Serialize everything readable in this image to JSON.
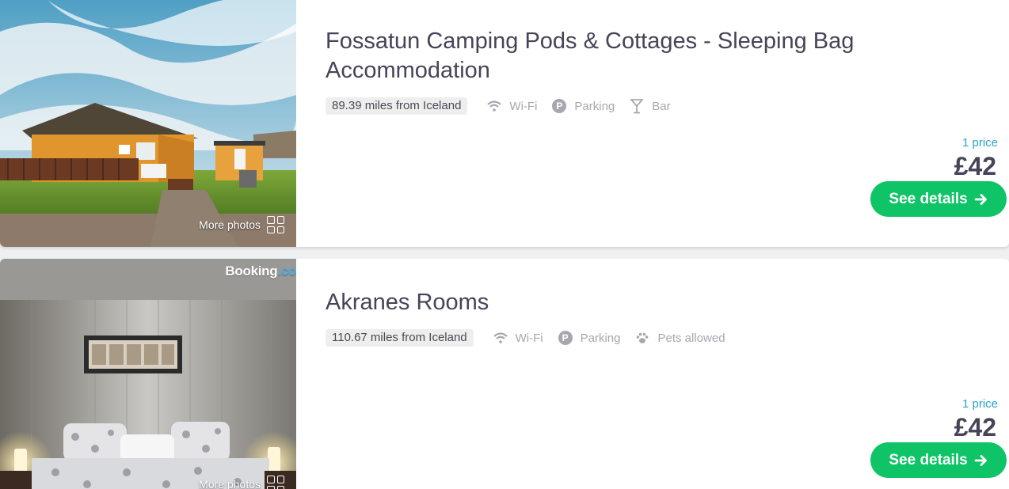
{
  "listings": [
    {
      "title": "Fossatun Camping Pods & Cottages - Sleeping Bag Accommodation",
      "distance": "89.39 miles from Iceland",
      "amenities": [
        {
          "icon": "wifi-icon",
          "label": "Wi-Fi"
        },
        {
          "icon": "parking-icon",
          "label": "Parking"
        },
        {
          "icon": "cocktail-icon",
          "label": "Bar"
        }
      ],
      "price_count": "1 price",
      "price": "£42",
      "details_label": "See details",
      "more_photos_label": "More photos"
    },
    {
      "title": "Akranes Rooms",
      "distance": "110.67 miles from Iceland",
      "amenities": [
        {
          "icon": "wifi-icon",
          "label": "Wi-Fi"
        },
        {
          "icon": "parking-icon",
          "label": "Parking"
        },
        {
          "icon": "paw-icon",
          "label": "Pets allowed"
        }
      ],
      "price_count": "1 price",
      "price": "£42",
      "details_label": "See details",
      "more_photos_label": "More photos",
      "photo_watermark": "Booking",
      "photo_watermark_suffix": ".co"
    }
  ],
  "parking_glyph": "P",
  "colors": {
    "accent_green": "#0fc466",
    "price_count_blue": "#2aa3c9",
    "title_text": "#474358",
    "amenity_grey": "#a7a7b0"
  }
}
